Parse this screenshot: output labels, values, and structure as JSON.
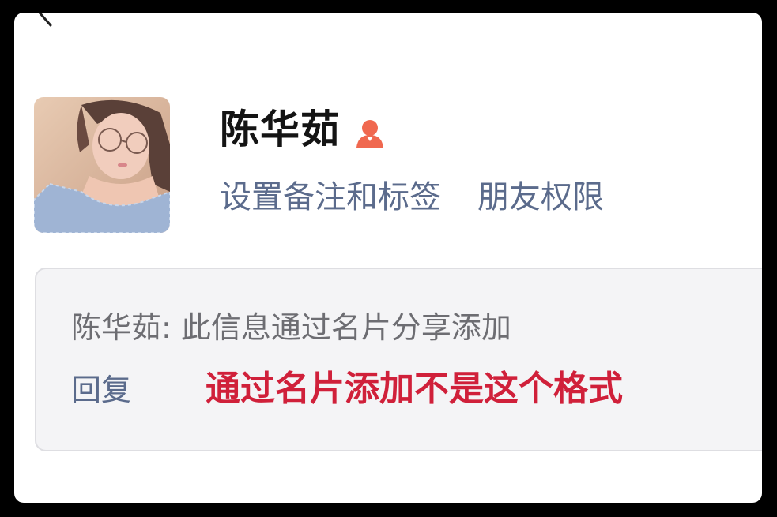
{
  "contact": {
    "name": "陈华茹",
    "gender_icon": "female-user-icon",
    "avatar_icon": "avatar-photo"
  },
  "actions": {
    "set_remark": "设置备注和标签",
    "friend_permissions": "朋友权限"
  },
  "verification": {
    "message": "陈华茹: 此信息通过名片分享添加",
    "reply_label": "回复"
  },
  "annotation": {
    "text": "通过名片添加不是这个格式"
  },
  "colors": {
    "link": "#5b6b8c",
    "gender_icon": "#f0684f",
    "annotation": "#d0203a",
    "message_bg": "#f4f4f6"
  }
}
